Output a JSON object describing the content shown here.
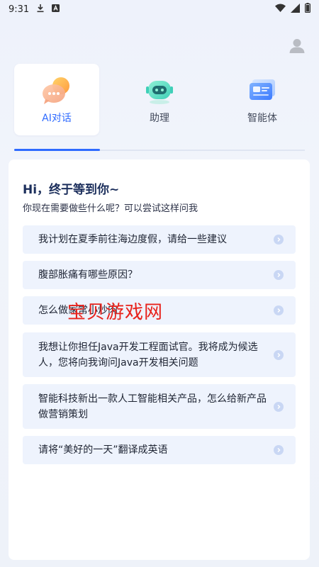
{
  "status_bar": {
    "time": "9:31",
    "icons": [
      "download-icon",
      "a-notification-icon",
      "wifi-icon",
      "signal-icon",
      "battery-icon"
    ]
  },
  "header": {
    "avatar_icon": "person-avatar-icon"
  },
  "tabs": [
    {
      "label": "AI对话",
      "icon": "chat-bubbles-icon",
      "active": true
    },
    {
      "label": "助理",
      "icon": "robot-assistant-icon",
      "active": false
    },
    {
      "label": "智能体",
      "icon": "agent-card-icon",
      "active": false
    }
  ],
  "main": {
    "greeting": "Hi，终于等到你~",
    "subtitle": "你现在需要做些什么呢？可以尝试这样问我",
    "suggestions": [
      "我计划在夏季前往海边度假，请给一些建议",
      "腹部胀痛有哪些原因？",
      "怎么做家常小炒肉",
      "我想让你担任Java开发工程面试官。我将成为候选人，您将向我询问Java开发相关问题",
      "智能科技新出一款人工智能相关产品，怎么给新产品做营销策划",
      "请将“美好的一天”翻译成英语"
    ]
  },
  "watermark": "宝贝游戏网",
  "colors": {
    "accent": "#2f6bff",
    "suggestion_bg": "#eef3fd",
    "watermark": "#e8231c"
  }
}
